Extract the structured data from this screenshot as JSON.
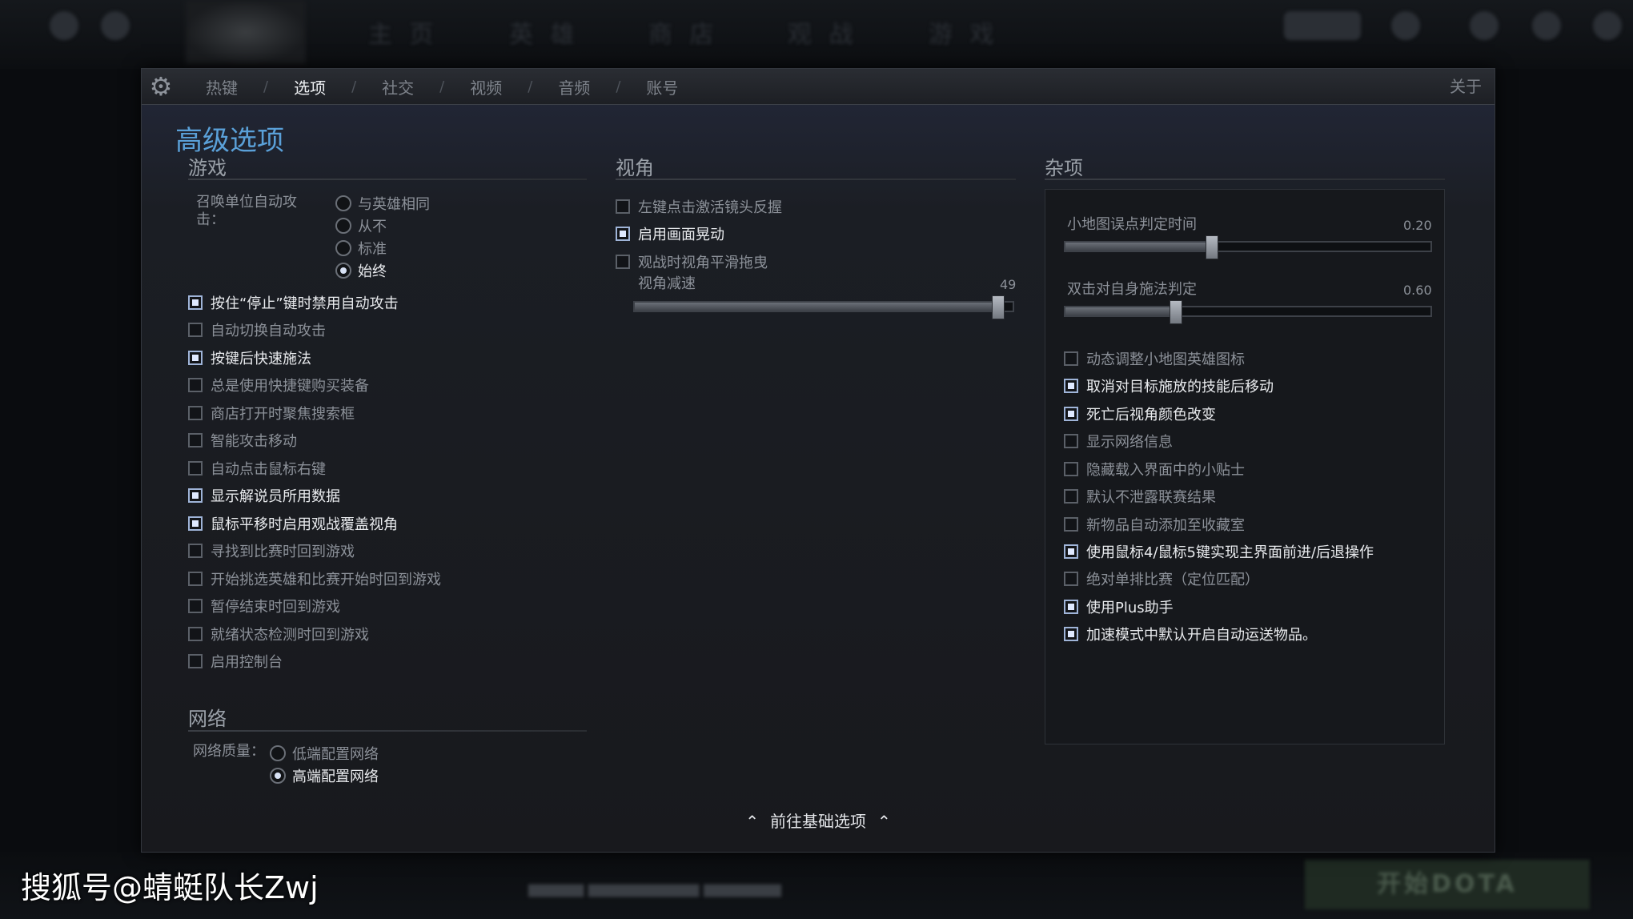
{
  "background": {
    "top_tabs": [
      "主 页",
      "英 雄",
      "商 店",
      "观 战",
      "游 戏"
    ],
    "play_button": "开始DOTA"
  },
  "topbar": {
    "tabs": [
      {
        "label": "热键",
        "active": false
      },
      {
        "label": "选项",
        "active": true
      },
      {
        "label": "社交",
        "active": false
      },
      {
        "label": "视频",
        "active": false
      },
      {
        "label": "音频",
        "active": false
      },
      {
        "label": "账号",
        "active": false
      }
    ],
    "separator": "/",
    "about": "关于"
  },
  "page_title": "高级选项",
  "game": {
    "title": "游戏",
    "summon_label": "召唤单位自动攻\n击：",
    "summon_options": [
      {
        "label": "与英雄相同",
        "selected": false
      },
      {
        "label": "从不",
        "selected": false
      },
      {
        "label": "标准",
        "selected": false
      },
      {
        "label": "始终",
        "selected": true
      }
    ],
    "checkboxes": [
      {
        "label": "按住“停止”键时禁用自动攻击",
        "checked": true
      },
      {
        "label": "自动切换自动攻击",
        "checked": false
      },
      {
        "label": "按键后快速施法",
        "checked": true
      },
      {
        "label": "总是使用快捷键购买装备",
        "checked": false
      },
      {
        "label": "商店打开时聚焦搜索框",
        "checked": false
      },
      {
        "label": "智能攻击移动",
        "checked": false
      },
      {
        "label": "自动点击鼠标右键",
        "checked": false
      },
      {
        "label": "显示解说员所用数据",
        "checked": true
      },
      {
        "label": "鼠标平移时启用观战覆盖视角",
        "checked": true
      },
      {
        "label": "寻找到比赛时回到游戏",
        "checked": false
      },
      {
        "label": "开始挑选英雄和比赛开始时回到游戏",
        "checked": false
      },
      {
        "label": "暂停结束时回到游戏",
        "checked": false
      },
      {
        "label": "就绪状态检测时回到游戏",
        "checked": false
      },
      {
        "label": "启用控制台",
        "checked": false
      }
    ]
  },
  "network": {
    "title": "网络",
    "quality_label": "网络质量：",
    "options": [
      {
        "label": "低端配置网络",
        "selected": false
      },
      {
        "label": "高端配置网络",
        "selected": true
      }
    ]
  },
  "camera": {
    "title": "视角",
    "checkboxes": [
      {
        "label": "左键点击激活镜头反握",
        "checked": false
      },
      {
        "label": "启用画面晃动",
        "checked": true
      },
      {
        "label": "观战时视角平滑拖曳",
        "checked": false
      }
    ],
    "slider": {
      "label": "视角减速",
      "value": "49",
      "fraction": 0.96
    }
  },
  "misc": {
    "title": "杂项",
    "sliders": [
      {
        "label": "小地图误点判定时间",
        "value": "0.20",
        "fraction": 0.4
      },
      {
        "label": "双击对自身施法判定",
        "value": "0.60",
        "fraction": 0.3
      }
    ],
    "checkboxes": [
      {
        "label": "动态调整小地图英雄图标",
        "checked": false
      },
      {
        "label": "取消对目标施放的技能后移动",
        "checked": true
      },
      {
        "label": "死亡后视角颜色改变",
        "checked": true
      },
      {
        "label": "显示网络信息",
        "checked": false
      },
      {
        "label": "隐藏载入界面中的小贴士",
        "checked": false
      },
      {
        "label": "默认不泄露联赛结果",
        "checked": false
      },
      {
        "label": "新物品自动添加至收藏室",
        "checked": false
      },
      {
        "label": "使用鼠标4/鼠标5键实现主界面前进/后退操作",
        "checked": true
      },
      {
        "label": "绝对单排比赛（定位匹配）",
        "checked": false
      },
      {
        "label": "使用Plus助手",
        "checked": true
      },
      {
        "label": "加速模式中默认开启自动运送物品。",
        "checked": true
      }
    ]
  },
  "footer": {
    "link": "前往基础选项"
  },
  "watermark": "搜狐号@蜻蜓队长Zwj"
}
